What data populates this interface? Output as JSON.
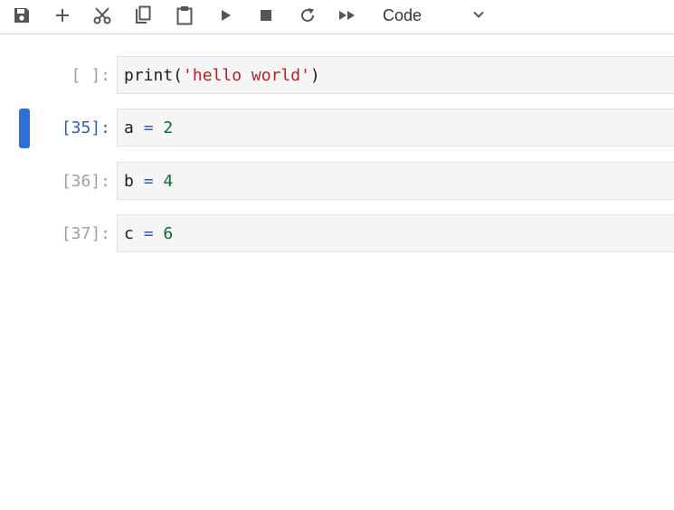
{
  "toolbar": {
    "buttons": [
      {
        "name": "save",
        "icon": "save-icon"
      },
      {
        "name": "insert-cell",
        "icon": "plus-icon"
      },
      {
        "name": "cut",
        "icon": "scissors-icon"
      },
      {
        "name": "copy",
        "icon": "copy-icon"
      },
      {
        "name": "paste",
        "icon": "clipboard-icon"
      },
      {
        "name": "run",
        "icon": "play-icon"
      },
      {
        "name": "interrupt",
        "icon": "stop-icon"
      },
      {
        "name": "restart",
        "icon": "refresh-icon"
      },
      {
        "name": "restart-run-all",
        "icon": "fast-forward-icon"
      }
    ],
    "cell_type": "Code",
    "cell_type_icon": "chevron-down-icon"
  },
  "cells": [
    {
      "prompt": "[ ]:",
      "active": false,
      "tokens": [
        {
          "t": "print(",
          "k": "name"
        },
        {
          "t": "'hello world'",
          "k": "str"
        },
        {
          "t": ")",
          "k": "name"
        }
      ]
    },
    {
      "prompt": "[35]:",
      "active": true,
      "tokens": [
        {
          "t": "a ",
          "k": "name"
        },
        {
          "t": "=",
          "k": "op"
        },
        {
          "t": " ",
          "k": "name"
        },
        {
          "t": "2",
          "k": "num"
        }
      ]
    },
    {
      "prompt": "[36]:",
      "active": false,
      "tokens": [
        {
          "t": "b ",
          "k": "name"
        },
        {
          "t": "=",
          "k": "op"
        },
        {
          "t": " ",
          "k": "name"
        },
        {
          "t": "4",
          "k": "num"
        }
      ]
    },
    {
      "prompt": "[37]:",
      "active": false,
      "tokens": [
        {
          "t": "c ",
          "k": "name"
        },
        {
          "t": "=",
          "k": "op"
        },
        {
          "t": " ",
          "k": "name"
        },
        {
          "t": "6",
          "k": "num"
        }
      ]
    }
  ],
  "colors": {
    "active_bar": "#2f6fd6",
    "string": "#b22222",
    "operator": "#2f5fb0",
    "number": "#0b6b2b"
  }
}
